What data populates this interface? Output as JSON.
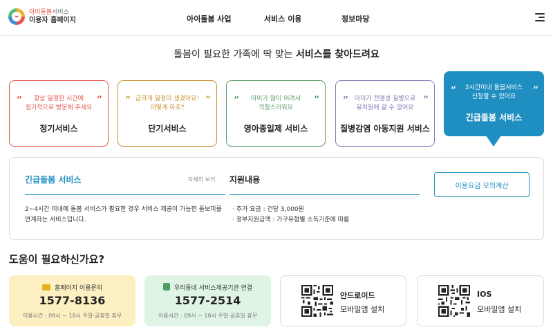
{
  "logo": {
    "line1_colored": "아이돌봄",
    "line1_rest": "서비스",
    "line2": "이용자 홈페이지"
  },
  "nav": {
    "items": [
      "아이돌봄 사업",
      "서비스 이용",
      "정보마당"
    ]
  },
  "headline": {
    "prefix": "돌봄이 필요한 가족에 딱 맞는 ",
    "bold": "서비스를 찾아드려요"
  },
  "services": [
    {
      "desc": "항상 일정한 시간에\n정기적으로 방문해 주세요",
      "title": "정기서비스",
      "color": "#e5534b"
    },
    {
      "desc": "급하게 일정이 생겼어요!\n어떻게 하죠?",
      "title": "단기서비스",
      "color": "#c9932f"
    },
    {
      "desc": "아이가 많이 어려서\n걱정스러워요",
      "title": "영아종일제 서비스",
      "color": "#5a9a6a"
    },
    {
      "desc": "아이가 전염성 질병으로\n유치원에 갈 수 없어요",
      "title": "질병감염 아동지원 서비스",
      "color": "#8579b5"
    },
    {
      "desc": "2시간이내 돌봄서비스\n신청할 수 있어요",
      "title": "긴급돌봄 서비스",
      "color": "#1f8fc1"
    }
  ],
  "quote_open": "“",
  "quote_close": "”",
  "detail": {
    "title": "긴급돌봄 서비스",
    "more": "자세히 보기",
    "text": "2~4시간 이내에 돌봄 서비스가 필요한 경우 서비스 제공이 가능한 돌보미를 연계하는 서비스입니다.",
    "support_title": "지원내용",
    "support_items": [
      "추가 요금 : 건당 3,000원",
      "정부지원금액 : 가구유형별 소득기준에 따름"
    ],
    "calc_button": "이용요금 모의계산"
  },
  "help": {
    "title": "도움이 필요하신가요?",
    "contacts": [
      {
        "label": "홈페이지 이용문의",
        "number": "1577-8136",
        "hours": "이용시간 : 09시 ~ 18시 주말·공휴일 휴무",
        "bg": "#fcefc2",
        "icon_color": "#e3b21e"
      },
      {
        "label": "우리동네 서비스제공기관 연결",
        "number": "1577-2514",
        "hours": "이용시간 : 09시 ~ 18시 주말·공휴일 휴무",
        "bg": "#e0f4e6",
        "icon_color": "#4c9e63"
      }
    ],
    "apps": [
      {
        "name": "안드로이드",
        "sub": "모바일앱 설치"
      },
      {
        "name": "IOS",
        "sub": "모바일앱 설치"
      }
    ]
  }
}
